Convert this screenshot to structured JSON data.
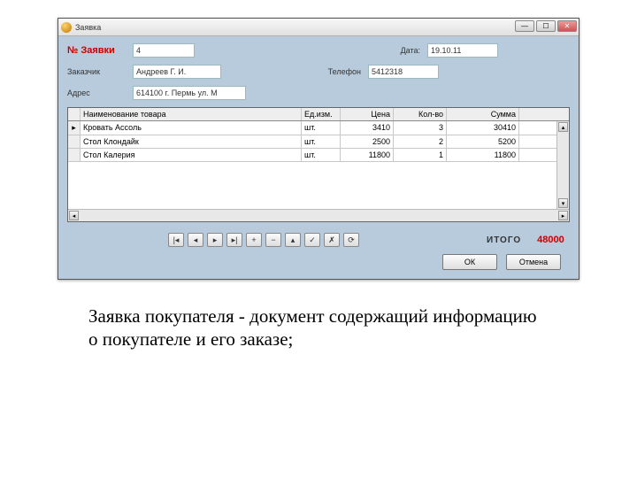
{
  "window": {
    "title": "Заявка"
  },
  "form": {
    "num_label": "№ Заявки",
    "num_value": "4",
    "date_label": "Дата:",
    "date_value": "19.10.11",
    "customer_label": "Заказчик",
    "customer_value": "Андреев Г. И.",
    "phone_label": "Телефон",
    "phone_value": "5412318",
    "address_label": "Адрес",
    "address_value": "614100 г. Пермь ул. М"
  },
  "grid": {
    "headers": {
      "name": "Наименование товара",
      "unit": "Ед.изм.",
      "price": "Цена",
      "qty": "Кол-во",
      "sum": "Сумма"
    },
    "rows": [
      {
        "name": "Кровать Ассоль",
        "unit": "шт.",
        "price": "3410",
        "qty": "3",
        "sum": "30410"
      },
      {
        "name": "Стол Клондайк",
        "unit": "шт.",
        "price": "2500",
        "qty": "2",
        "sum": "5200"
      },
      {
        "name": "Стол Калерия",
        "unit": "шт.",
        "price": "11800",
        "qty": "1",
        "sum": "11800"
      }
    ]
  },
  "nav": {
    "first": "|◂",
    "prev": "◂",
    "next": "▸",
    "last": "▸|",
    "add": "+",
    "del": "−",
    "edit": "▴",
    "ok": "✓",
    "cancel": "✗",
    "refresh": "⟳"
  },
  "totals": {
    "label": "ИТОГО",
    "value": "48000"
  },
  "buttons": {
    "ok": "ОК",
    "cancel": "Отмена"
  },
  "caption": "Заявка покупателя -  документ содержащий информацию о покупателе и его заказе;"
}
